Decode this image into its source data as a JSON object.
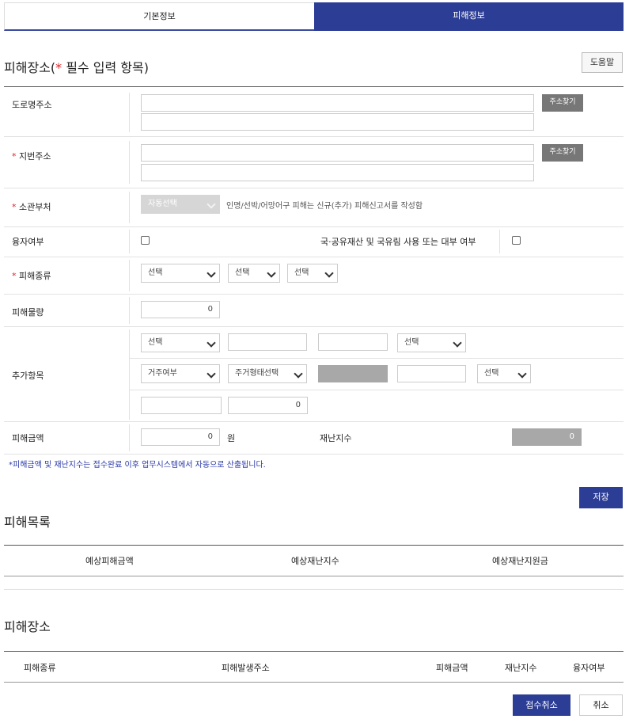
{
  "tabs": {
    "basic": "기본정보",
    "damage": "피해정보"
  },
  "section1": {
    "title_prefix": "피해장소(",
    "required_mark": "*",
    "title_suffix": " 필수 입력 항목)",
    "help_button": "도움말"
  },
  "fields": {
    "road_address": {
      "label": "도로명주소",
      "button": "주소찾기"
    },
    "lot_address": {
      "required": "*",
      "label": "지번주소",
      "button": "주소찾기"
    },
    "department": {
      "required": "*",
      "label": "소관부처",
      "value": "자동선택",
      "hint": "인명/선박/어망어구 피해는 신규(추가) 피해신고서를 작성함"
    },
    "loan": {
      "label": "융자여부",
      "public_label": "국·공유재산 및 국유림 사용 또는 대부 여부"
    },
    "damage_type": {
      "required": "*",
      "label": "피해종류",
      "sel1": "선택",
      "sel2": "선택",
      "sel3": "선택"
    },
    "damage_amount": {
      "label": "피해물량",
      "value": "0"
    },
    "extra": {
      "label": "추가항목",
      "sel_a": "선택",
      "sel_b": "선택",
      "sel_c": "거주여부",
      "sel_d": "주거형태선택",
      "sel_e": "선택",
      "num_value": "0"
    },
    "damage_cost": {
      "label": "피해금액",
      "value": "0",
      "unit": "원",
      "disaster_label": "재난지수",
      "disaster_value": "0"
    }
  },
  "note": "*피해금액 및 재난지수는 접수완료 이후 업무시스템에서 자동으로 산출됩니다.",
  "save_button": "저장",
  "list1": {
    "title": "피해목록",
    "col1": "예상피해금액",
    "col2": "예상재난지수",
    "col3": "예상재난지원금"
  },
  "list2": {
    "title": "피해장소",
    "col1": "피해종류",
    "col2": "피해발생주소",
    "col3": "피해금액",
    "col4": "재난지수",
    "col5": "융자여부"
  },
  "footer": {
    "cancel_receipt": "접수취소",
    "cancel": "취소"
  },
  "colors": {
    "primary": "#2c3d96",
    "required": "#d9262c",
    "note": "#2838a8"
  }
}
